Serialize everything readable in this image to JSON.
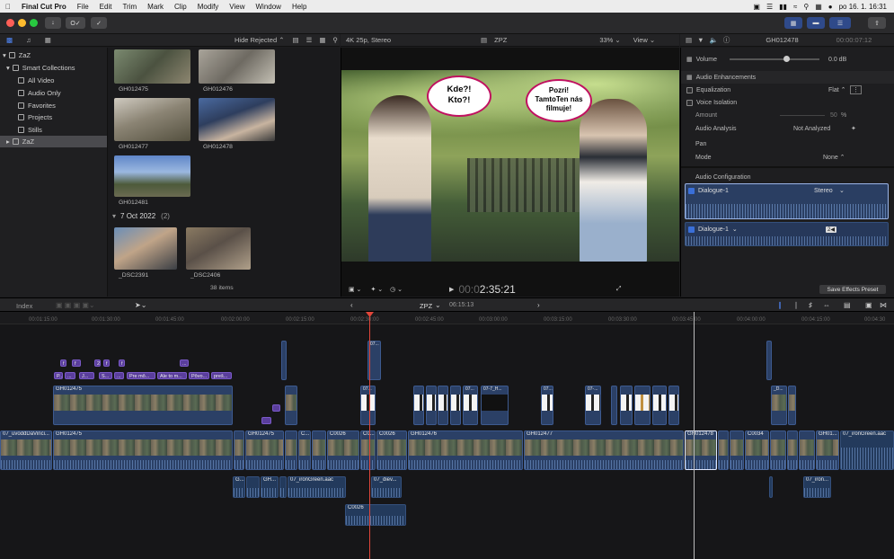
{
  "menubar": {
    "app": "Final Cut Pro",
    "items": [
      "File",
      "Edit",
      "Trim",
      "Mark",
      "Clip",
      "Modify",
      "View",
      "Window",
      "Help"
    ],
    "datetime": "po 16. 1.  16:31"
  },
  "toolbar": {
    "key_label": "O✓"
  },
  "sidebar": {
    "library": "ZaZ",
    "smart_collections": "Smart Collections",
    "items": [
      "All Video",
      "Audio Only",
      "Favorites",
      "Projects",
      "Stills"
    ],
    "event": "ZaZ"
  },
  "browser": {
    "filter": "Hide Rejected ⌃",
    "clips_top": [
      "GH012475",
      "GH012476",
      "GH012477",
      "GH012478",
      "GH012481"
    ],
    "date_group": "7 Oct 2022",
    "date_count": "(2)",
    "clips_bottom": [
      "_DSC2391",
      "_DSC2406"
    ],
    "item_count": "38 items"
  },
  "viewer": {
    "format": "4K 25p, Stereo",
    "project": "ZPZ",
    "zoom": "33%",
    "view_label": "View",
    "bubble_left": [
      "Kde?!",
      "Kto?!"
    ],
    "bubble_right": [
      "Pozri!",
      "TamtoTen nás",
      "filmuje!"
    ],
    "timecode_dim": "00:0",
    "timecode": "2:35:21"
  },
  "inspector": {
    "clip_name": "GH012478",
    "duration": "00:00:07:12",
    "volume_label": "Volume",
    "volume_value": "0.0  dB",
    "enhancements": "Audio Enhancements",
    "equalization": "Equalization",
    "equalization_value": "Flat ⌃",
    "voice_isolation": "Voice Isolation",
    "amount_label": "Amount",
    "amount_value": "50",
    "amount_unit": "%",
    "analysis_label": "Audio Analysis",
    "analysis_value": "Not Analyzed",
    "pan_label": "Pan",
    "mode_label": "Mode",
    "mode_value": "None ⌃",
    "config_label": "Audio Configuration",
    "role1": "Dialogue-1",
    "role1_format": "Stereo",
    "role2": "Dialogue-1",
    "role2_badge": "2◀",
    "save_preset": "Save Effects Preset"
  },
  "timeline_bar": {
    "index": "Index",
    "project": "ZPZ",
    "duration": "06:15:13"
  },
  "ruler_ticks": [
    "00:01:15:00",
    "00:01:30:00",
    "00:01:45:00",
    "00:02:00:00",
    "00:02:15:00",
    "00:02:30:00",
    "00:02:45:00",
    "00:03:00:00",
    "00:03:15:00",
    "00:03:30:00",
    "00:03:45:00",
    "00:04:00:00",
    "00:04:15:00",
    "00:04:30"
  ],
  "titles_row1": [
    "f",
    "f",
    "2",
    "f",
    "f",
    "..."
  ],
  "titles_row2": [
    "P...",
    "...",
    "J...",
    "S...",
    "...",
    "Pre mô...",
    "Ale to m...",
    "Pôvo...",
    "preš..."
  ],
  "connected_video": {
    "main": "GH012475",
    "b1": "07...",
    "b2": "07...",
    "b3": "07...",
    "b4": "07-7_H...",
    "b5": "07...",
    "b6": "07-...",
    "b7": "_D..."
  },
  "primary": {
    "c1": "07_uvoddDaVinci...",
    "c2": "GH012475",
    "c3": "GH012475",
    "c4": "C...",
    "c5": "C0026",
    "c6": "C0...",
    "c7": "C0026",
    "c8": "GH012476",
    "c9": "GH012477",
    "c10": "GH012478",
    "c11": "C0034",
    "c12": "GH01...",
    "c13": "07_ironGreen.aac"
  },
  "audio_clips": {
    "a1": "G...",
    "a2": "GH...",
    "a3": "07_ironGreen.aac",
    "a4": "07_diev...",
    "a5": "07_iron...",
    "a6": "C0026"
  }
}
